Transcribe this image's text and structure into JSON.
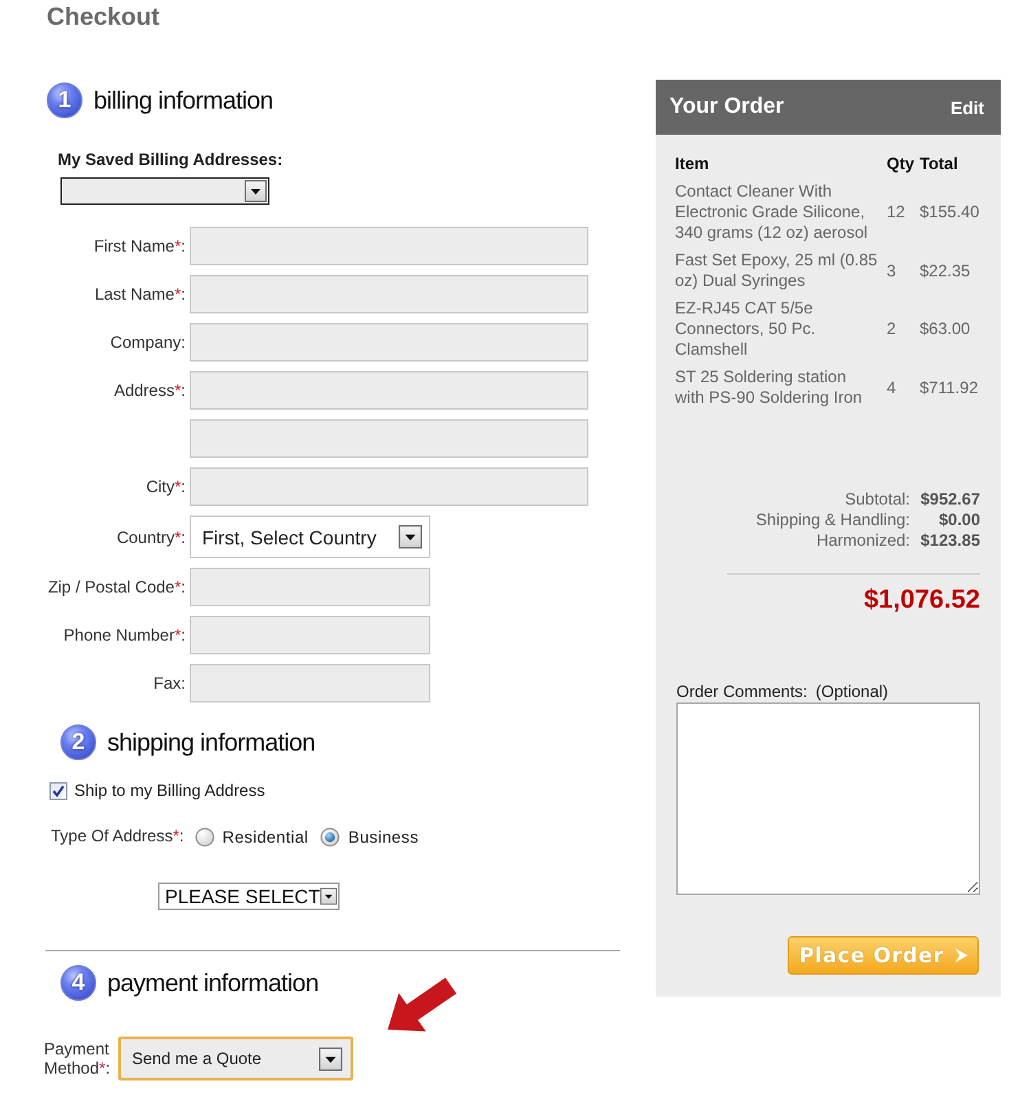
{
  "page": {
    "title": "Checkout"
  },
  "billing": {
    "step": "1",
    "title": "billing information",
    "saved_addresses": {
      "label": "My Saved Billing Addresses:"
    },
    "fields": [
      {
        "kind": "text",
        "label": "First Name",
        "required_mark": "*",
        "colon": ":"
      },
      {
        "kind": "text",
        "label": "Last Name",
        "required_mark": "*",
        "colon": ":"
      },
      {
        "kind": "text",
        "label": "Company",
        "colon": ":"
      },
      {
        "kind": "text",
        "label": "Address",
        "required_mark": "*",
        "colon": ":"
      },
      {
        "kind": "text"
      },
      {
        "kind": "text",
        "label": "City",
        "required_mark": "*",
        "colon": ":"
      },
      {
        "kind": "select",
        "label": "Country",
        "required_mark": "*",
        "colon": ":",
        "value": "First, Select Country"
      },
      {
        "kind": "text",
        "label": "Zip / Postal Code",
        "required_mark": "*",
        "colon": ":"
      },
      {
        "kind": "text",
        "label": "Phone Number",
        "required_mark": "*",
        "colon": ":"
      },
      {
        "kind": "text",
        "label": "Fax",
        "colon": ":"
      }
    ]
  },
  "shipping": {
    "step": "2",
    "title": "shipping information",
    "same_as_billing": {
      "label": "Ship to my Billing Address",
      "checked": true
    },
    "address_type": {
      "label": "Type Of Address",
      "required_mark": "*",
      "colon": ":",
      "options": [
        {
          "label": "Residential",
          "selected": false
        },
        {
          "label": "Business",
          "selected": true
        }
      ]
    },
    "method_select": {
      "value": "PLEASE SELECT"
    }
  },
  "payment": {
    "step": "4",
    "title": "payment information",
    "method": {
      "label": "Payment Method",
      "required_mark": "*",
      "colon": ":",
      "value": "Send me a Quote",
      "focused": true
    }
  },
  "order": {
    "title": "Your Order",
    "edit_link": "Edit",
    "columns": [
      "Item",
      "Qty",
      "Total"
    ],
    "items": [
      {
        "item": "Contact Cleaner With Electronic Grade Silicone, 340 grams (12 oz) aerosol",
        "qty": "12",
        "total": "$155.40"
      },
      {
        "item": "Fast Set Epoxy, 25 ml (0.85 oz) Dual Syringes",
        "qty": "3",
        "total": "$22.35"
      },
      {
        "item": "EZ-RJ45 CAT 5/5e Connectors, 50 Pc. Clamshell",
        "qty": "2",
        "total": "$63.00"
      },
      {
        "item": "ST 25 Soldering station with PS-90 Soldering Iron",
        "qty": "4",
        "total": "$711.92"
      }
    ],
    "totals": [
      {
        "label": "Subtotal:",
        "value": "$952.67"
      },
      {
        "label": "Shipping & Handling:",
        "value": "$0.00"
      },
      {
        "label": "Harmonized:",
        "value": "$123.85"
      }
    ],
    "grand_total": "$1,076.52",
    "comments": {
      "label": "Order Comments:",
      "hint": "(Optional)"
    },
    "button": "Place Order"
  }
}
